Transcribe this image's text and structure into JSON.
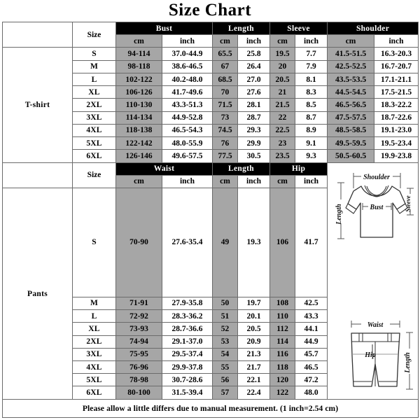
{
  "title": "Size Chart",
  "colors": {
    "header_bg": "#000000",
    "header_text": "#ffffff",
    "cell_gray": "#a6a6a6",
    "cell_white": "#ffffff",
    "border": "#6b6b6b"
  },
  "tshirt": {
    "label": "T-shirt",
    "size_header": "Size",
    "groups": [
      {
        "name": "Bust",
        "units": [
          "cm",
          "inch"
        ]
      },
      {
        "name": "Length",
        "units": [
          "cm",
          "inch"
        ]
      },
      {
        "name": "Sleeve",
        "units": [
          "cm",
          "inch"
        ]
      },
      {
        "name": "Shoulder",
        "units": [
          "cm",
          "inch"
        ]
      }
    ],
    "rows": [
      {
        "size": "S",
        "bust_cm": "94-114",
        "bust_in": "37.0-44.9",
        "length_cm": "65.5",
        "length_in": "25.8",
        "sleeve_cm": "19.5",
        "sleeve_in": "7.7",
        "shoulder_cm": "41.5-51.5",
        "shoulder_in": "16.3-20.3"
      },
      {
        "size": "M",
        "bust_cm": "98-118",
        "bust_in": "38.6-46.5",
        "length_cm": "67",
        "length_in": "26.4",
        "sleeve_cm": "20",
        "sleeve_in": "7.9",
        "shoulder_cm": "42.5-52.5",
        "shoulder_in": "16.7-20.7"
      },
      {
        "size": "L",
        "bust_cm": "102-122",
        "bust_in": "40.2-48.0",
        "length_cm": "68.5",
        "length_in": "27.0",
        "sleeve_cm": "20.5",
        "sleeve_in": "8.1",
        "shoulder_cm": "43.5-53.5",
        "shoulder_in": "17.1-21.1"
      },
      {
        "size": "XL",
        "bust_cm": "106-126",
        "bust_in": "41.7-49.6",
        "length_cm": "70",
        "length_in": "27.6",
        "sleeve_cm": "21",
        "sleeve_in": "8.3",
        "shoulder_cm": "44.5-54.5",
        "shoulder_in": "17.5-21.5"
      },
      {
        "size": "2XL",
        "bust_cm": "110-130",
        "bust_in": "43.3-51.3",
        "length_cm": "71.5",
        "length_in": "28.1",
        "sleeve_cm": "21.5",
        "sleeve_in": "8.5",
        "shoulder_cm": "46.5-56.5",
        "shoulder_in": "18.3-22.2"
      },
      {
        "size": "3XL",
        "bust_cm": "114-134",
        "bust_in": "44.9-52.8",
        "length_cm": "73",
        "length_in": "28.7",
        "sleeve_cm": "22",
        "sleeve_in": "8.7",
        "shoulder_cm": "47.5-57.5",
        "shoulder_in": "18.7-22.6"
      },
      {
        "size": "4XL",
        "bust_cm": "118-138",
        "bust_in": "46.5-54.3",
        "length_cm": "74.5",
        "length_in": "29.3",
        "sleeve_cm": "22.5",
        "sleeve_in": "8.9",
        "shoulder_cm": "48.5-58.5",
        "shoulder_in": "19.1-23.0"
      },
      {
        "size": "5XL",
        "bust_cm": "122-142",
        "bust_in": "48.0-55.9",
        "length_cm": "76",
        "length_in": "29.9",
        "sleeve_cm": "23",
        "sleeve_in": "9.1",
        "shoulder_cm": "49.5-59.5",
        "shoulder_in": "19.5-23.4"
      },
      {
        "size": "6XL",
        "bust_cm": "126-146",
        "bust_in": "49.6-57.5",
        "length_cm": "77.5",
        "length_in": "30.5",
        "sleeve_cm": "23.5",
        "sleeve_in": "9.3",
        "shoulder_cm": "50.5-60.5",
        "shoulder_in": "19.9-23.8"
      }
    ]
  },
  "pants": {
    "label": "Pants",
    "size_header": "Size",
    "groups": [
      {
        "name": "Waist",
        "units": [
          "cm",
          "inch"
        ]
      },
      {
        "name": "Length",
        "units": [
          "cm",
          "inch"
        ]
      },
      {
        "name": "Hip",
        "units": [
          "cm",
          "inch"
        ]
      }
    ],
    "rows": [
      {
        "size": "S",
        "waist_cm": "70-90",
        "waist_in": "27.6-35.4",
        "length_cm": "49",
        "length_in": "19.3",
        "hip_cm": "106",
        "hip_in": "41.7"
      },
      {
        "size": "M",
        "waist_cm": "71-91",
        "waist_in": "27.9-35.8",
        "length_cm": "50",
        "length_in": "19.7",
        "hip_cm": "108",
        "hip_in": "42.5"
      },
      {
        "size": "L",
        "waist_cm": "72-92",
        "waist_in": "28.3-36.2",
        "length_cm": "51",
        "length_in": "20.1",
        "hip_cm": "110",
        "hip_in": "43.3"
      },
      {
        "size": "XL",
        "waist_cm": "73-93",
        "waist_in": "28.7-36.6",
        "length_cm": "52",
        "length_in": "20.5",
        "hip_cm": "112",
        "hip_in": "44.1"
      },
      {
        "size": "2XL",
        "waist_cm": "74-94",
        "waist_in": "29.1-37.0",
        "length_cm": "53",
        "length_in": "20.9",
        "hip_cm": "114",
        "hip_in": "44.9"
      },
      {
        "size": "3XL",
        "waist_cm": "75-95",
        "waist_in": "29.5-37.4",
        "length_cm": "54",
        "length_in": "21.3",
        "hip_cm": "116",
        "hip_in": "45.7"
      },
      {
        "size": "4XL",
        "waist_cm": "76-96",
        "waist_in": "29.9-37.8",
        "length_cm": "55",
        "length_in": "21.7",
        "hip_cm": "118",
        "hip_in": "46.5"
      },
      {
        "size": "5XL",
        "waist_cm": "78-98",
        "waist_in": "30.7-28.6",
        "length_cm": "56",
        "length_in": "22.1",
        "hip_cm": "120",
        "hip_in": "47.2"
      },
      {
        "size": "6XL",
        "waist_cm": "80-100",
        "waist_in": "31.5-39.4",
        "length_cm": "57",
        "length_in": "22.4",
        "hip_cm": "122",
        "hip_in": "48.0"
      }
    ]
  },
  "diagrams": {
    "tshirt": {
      "name": "tshirt-diagram",
      "labels": {
        "shoulder": "Shoulder",
        "sleeve": "Sleeve",
        "bust": "Bust",
        "length": "Length"
      }
    },
    "shorts": {
      "name": "shorts-diagram",
      "labels": {
        "waist": "Waist",
        "hip": "Hip",
        "length": "Length"
      }
    }
  },
  "footer": {
    "note": "Please allow a little differs due to manual measurement. (1 inch=2.54 cm)"
  }
}
